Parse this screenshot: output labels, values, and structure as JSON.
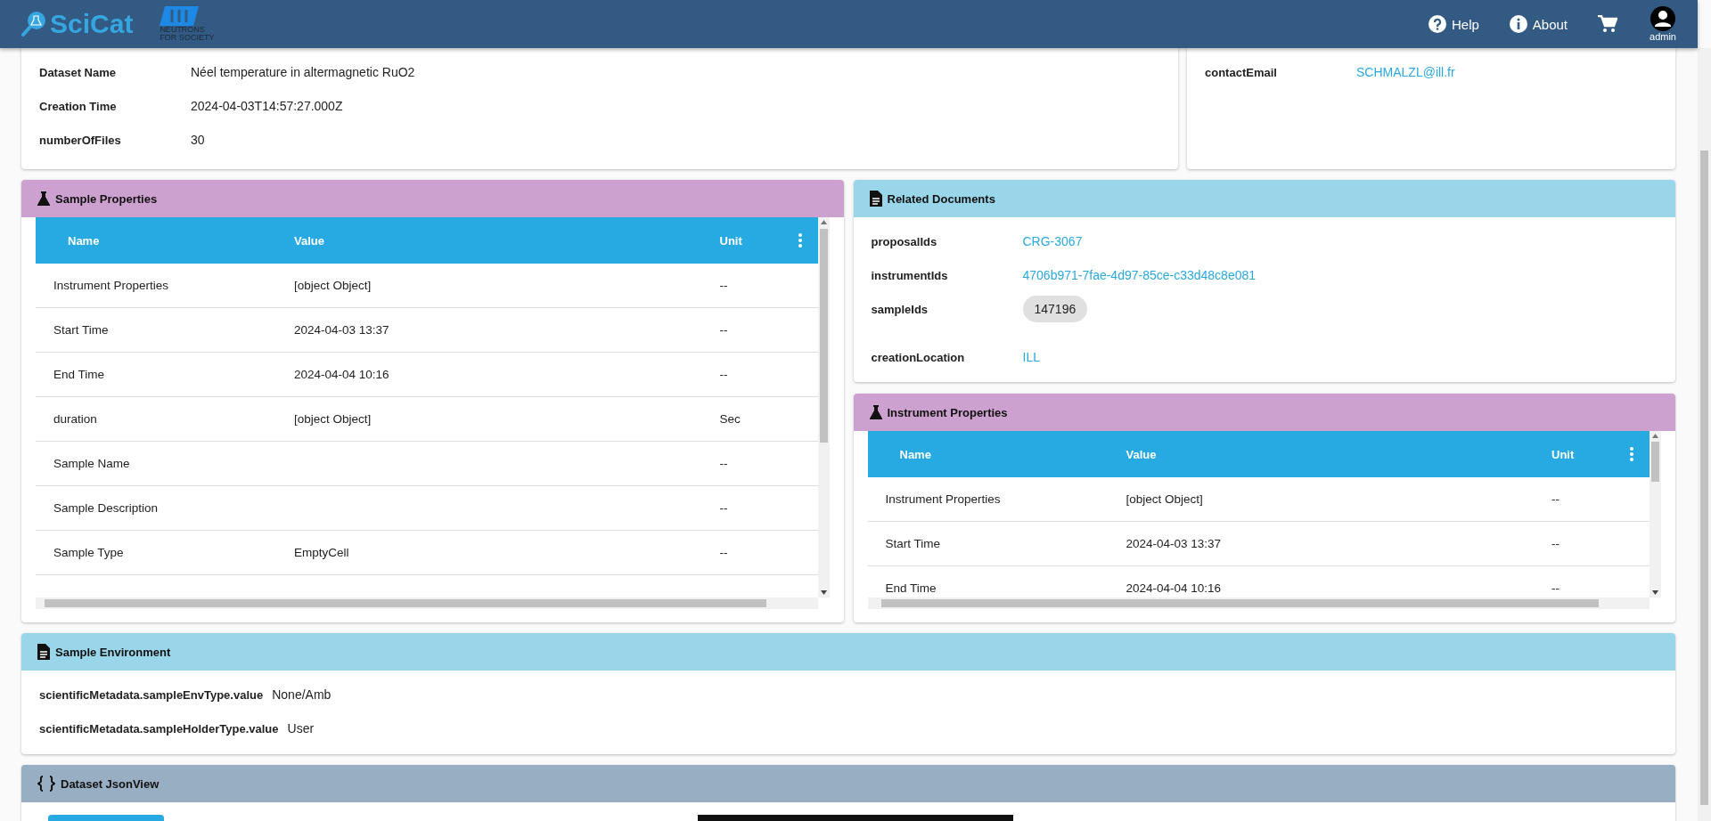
{
  "header": {
    "brand": "SciCat",
    "org_logo_text": "NEUTRONS FOR SOCIETY",
    "nav": [
      {
        "kind": "help",
        "label": "Help"
      },
      {
        "kind": "about",
        "label": "About"
      },
      {
        "kind": "cart"
      }
    ],
    "user": "admin"
  },
  "general": {
    "fields": [
      {
        "label": "Dataset Name",
        "value": "Néel temperature in altermagnetic RuO2"
      },
      {
        "label": "Creation Time",
        "value": "2024-04-03T14:57:27.000Z"
      },
      {
        "label": "numberOfFiles",
        "value": "30"
      }
    ]
  },
  "contact": {
    "fields": [
      {
        "label": "contactEmail",
        "value": "SCHMALZL@ill.fr",
        "kind": "link"
      }
    ]
  },
  "sample_properties": {
    "title": "Sample Properties",
    "columns": [
      "Name",
      "Value",
      "Unit"
    ],
    "rows": [
      {
        "name": "Instrument Properties",
        "value": "[object Object]",
        "unit": "--"
      },
      {
        "name": "Start Time",
        "value": "2024-04-03 13:37",
        "unit": "--"
      },
      {
        "name": "End Time",
        "value": "2024-04-04 10:16",
        "unit": "--"
      },
      {
        "name": "duration",
        "value": "[object Object]",
        "unit": "Sec"
      },
      {
        "name": "Sample Name",
        "value": "",
        "unit": "--"
      },
      {
        "name": "Sample Description",
        "value": "",
        "unit": "--"
      },
      {
        "name": "Sample Type",
        "value": "EmptyCell",
        "unit": "--"
      }
    ]
  },
  "related_documents": {
    "title": "Related Documents",
    "fields": [
      {
        "label": "proposalIds",
        "value": "CRG-3067",
        "kind": "link"
      },
      {
        "label": "instrumentIds",
        "value": "4706b971-7fae-4d97-85ce-c33d48c8e081",
        "kind": "link"
      },
      {
        "label": "sampleIds",
        "value": "147196",
        "kind": "chip"
      },
      {
        "label": "creationLocation",
        "value": "ILL",
        "kind": "link"
      }
    ]
  },
  "instrument_properties": {
    "title": "Instrument Properties",
    "columns": [
      "Name",
      "Value",
      "Unit"
    ],
    "rows": [
      {
        "name": "Instrument Properties",
        "value": "[object Object]",
        "unit": "--"
      },
      {
        "name": "Start Time",
        "value": "2024-04-03 13:37",
        "unit": "--"
      },
      {
        "name": "End Time",
        "value": "2024-04-04 10:16",
        "unit": "--"
      }
    ]
  },
  "sample_environment": {
    "title": "Sample Environment",
    "fields": [
      {
        "label": "scientificMetadata.sampleEnvType.value",
        "value": "None/Amb"
      },
      {
        "label": "scientificMetadata.sampleHolderType.value",
        "value": "User"
      }
    ]
  },
  "json_view": {
    "title": "Dataset JsonView"
  }
}
